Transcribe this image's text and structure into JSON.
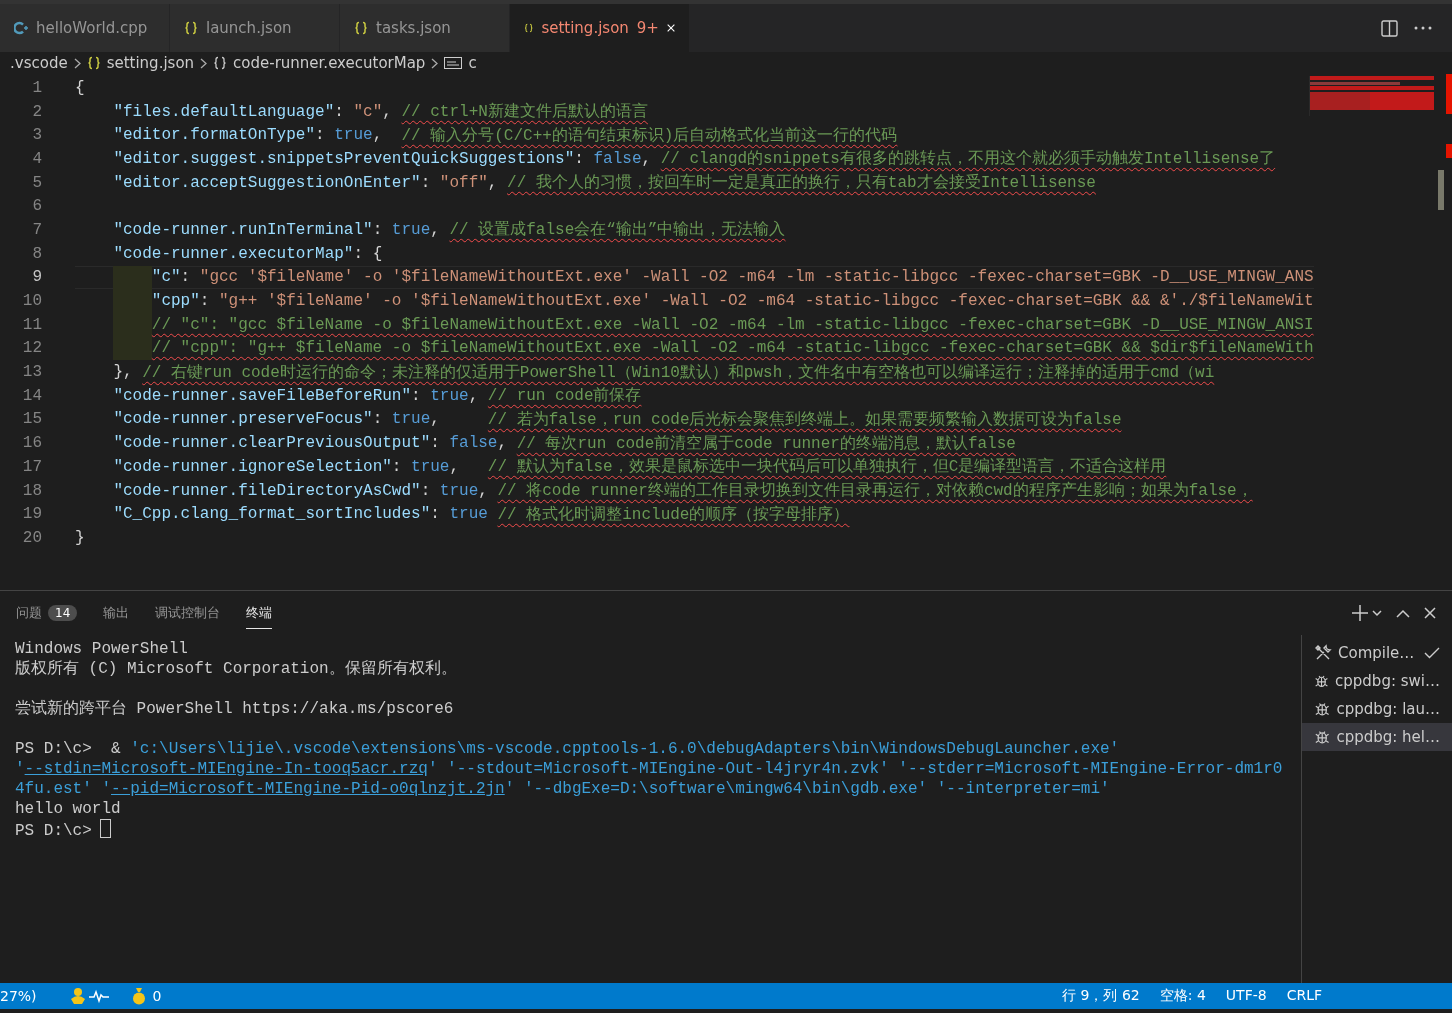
{
  "tabs": [
    {
      "label": "helloWorld.cpp",
      "kind": "cpp",
      "selected": false
    },
    {
      "label": "launch.json",
      "kind": "json",
      "selected": false
    },
    {
      "label": "tasks.json",
      "kind": "json",
      "selected": false
    },
    {
      "label": "setting.json",
      "kind": "json",
      "selected": true,
      "problems": "9+"
    }
  ],
  "breadcrumbs": [
    {
      "label": ".vscode",
      "kind": "folder"
    },
    {
      "label": "setting.json",
      "kind": "json"
    },
    {
      "label": "code-runner.executorMap",
      "kind": "object"
    },
    {
      "label": "c",
      "kind": "string"
    }
  ],
  "editor": {
    "lines": [
      {
        "number": "1",
        "current": false,
        "tokens": [
          {
            "kind": "punct",
            "text": "{"
          }
        ],
        "children": [
          {
            "number": "2",
            "current": false,
            "tokens": [
              {
                "kind": "key",
                "text": "\"files.defaultLanguage\""
              },
              {
                "kind": "punct",
                "text": ": "
              },
              {
                "kind": "string",
                "text": "\"c\""
              },
              {
                "kind": "punct",
                "text": ", "
              },
              {
                "kind": "comment",
                "text": "// ctrl+N新建文件后默认的语言"
              }
            ]
          },
          {
            "number": "3",
            "current": false,
            "tokens": [
              {
                "kind": "key",
                "text": "\"editor.formatOnType\""
              },
              {
                "kind": "punct",
                "text": ": "
              },
              {
                "kind": "bool",
                "text": "true"
              },
              {
                "kind": "punct",
                "text": ",  "
              },
              {
                "kind": "comment",
                "text": "// 输入分号(C/C++的语句结束标识)后自动格式化当前这一行的代码"
              }
            ]
          },
          {
            "number": "4",
            "current": false,
            "tokens": [
              {
                "kind": "key",
                "text": "\"editor.suggest.snippetsPreventQuickSuggestions\""
              },
              {
                "kind": "punct",
                "text": ": "
              },
              {
                "kind": "bool",
                "text": "false"
              },
              {
                "kind": "punct",
                "text": ", "
              },
              {
                "kind": "comment",
                "text": "// clangd的snippets有很多的跳转点，不用这个就必须手动触发Intellisense了"
              }
            ]
          },
          {
            "number": "5",
            "current": false,
            "tokens": [
              {
                "kind": "key",
                "text": "\"editor.acceptSuggestionOnEnter\""
              },
              {
                "kind": "punct",
                "text": ": "
              },
              {
                "kind": "string",
                "text": "\"off\""
              },
              {
                "kind": "punct",
                "text": ", "
              },
              {
                "kind": "comment",
                "text": "// 我个人的习惯，按回车时一定是真正的换行，只有tab才会接受Intellisense"
              }
            ]
          },
          {
            "number": "6",
            "current": false
          },
          {
            "number": "7",
            "current": false,
            "tokens": [
              {
                "kind": "key",
                "text": "\"code-runner.runInTerminal\""
              },
              {
                "kind": "punct",
                "text": ": "
              },
              {
                "kind": "bool",
                "text": "true"
              },
              {
                "kind": "punct",
                "text": ", "
              },
              {
                "kind": "comment",
                "text": "// 设置成false会在“输出”中输出，无法输入"
              }
            ]
          },
          {
            "number": "8",
            "current": false,
            "tokens": [
              {
                "kind": "key",
                "text": "\"code-runner.executorMap\""
              },
              {
                "kind": "punct",
                "text": ": {"
              }
            ],
            "children": [
              {
                "number": "9",
                "current": true,
                "tokens": [
                  {
                    "kind": "key",
                    "text": "\"c\""
                  },
                  {
                    "kind": "punct",
                    "text": ": "
                  },
                  {
                    "kind": "string",
                    "text": "\"gcc '$fileName' -o '$fileNameWithoutExt.exe' -Wall -O2 -m64 -lm -static-libgcc -fexec-charset=GBK -D__USE_MINGW_ANS"
                  }
                ]
              },
              {
                "number": "10",
                "current": false,
                "tokens": [
                  {
                    "kind": "key",
                    "text": "\"cpp\""
                  },
                  {
                    "kind": "punct",
                    "text": ": "
                  },
                  {
                    "kind": "string",
                    "text": "\"g++ '$fileName' -o '$fileNameWithoutExt.exe' -Wall -O2 -m64 -static-libgcc -fexec-charset=GBK && &'./$fileNameWit"
                  }
                ]
              },
              {
                "number": "11",
                "current": false,
                "tokens": [
                  {
                    "kind": "comment",
                    "text": "// \"c\": \"gcc $fileName -o $fileNameWithoutExt.exe -Wall -O2 -m64 -lm -static-libgcc -fexec-charset=GBK -D__USE_MINGW_ANSI"
                  }
                ]
              },
              {
                "number": "12",
                "current": false,
                "tokens": [
                  {
                    "kind": "comment",
                    "text": "// \"cpp\": \"g++ $fileName -o $fileNameWithoutExt.exe -Wall -O2 -m64 -static-libgcc -fexec-charset=GBK && $dir$fileNameWith"
                  }
                ]
              }
            ]
          },
          {
            "number": "13",
            "current": false,
            "tokens": [
              {
                "kind": "punct",
                "text": "}, "
              },
              {
                "kind": "comment",
                "text": "// 右键run code时运行的命令；未注释的仅适用于PowerShell（Win10默认）和pwsh，文件名中有空格也可以编译运行；注释掉的适用于cmd（wi"
              }
            ]
          },
          {
            "number": "14",
            "current": false,
            "tokens": [
              {
                "kind": "key",
                "text": "\"code-runner.saveFileBeforeRun\""
              },
              {
                "kind": "punct",
                "text": ": "
              },
              {
                "kind": "bool",
                "text": "true"
              },
              {
                "kind": "punct",
                "text": ", "
              },
              {
                "kind": "comment",
                "text": "// run code前保存"
              }
            ]
          },
          {
            "number": "15",
            "current": false,
            "tokens": [
              {
                "kind": "key",
                "text": "\"code-runner.preserveFocus\""
              },
              {
                "kind": "punct",
                "text": ": "
              },
              {
                "kind": "bool",
                "text": "true"
              },
              {
                "kind": "punct",
                "text": ",     "
              },
              {
                "kind": "comment",
                "text": "// 若为false，run code后光标会聚焦到终端上。如果需要频繁输入数据可设为false"
              }
            ]
          },
          {
            "number": "16",
            "current": false,
            "tokens": [
              {
                "kind": "key",
                "text": "\"code-runner.clearPreviousOutput\""
              },
              {
                "kind": "punct",
                "text": ": "
              },
              {
                "kind": "bool",
                "text": "false"
              },
              {
                "kind": "punct",
                "text": ", "
              },
              {
                "kind": "comment",
                "text": "// 每次run code前清空属于code runner的终端消息，默认false"
              }
            ]
          },
          {
            "number": "17",
            "current": false,
            "tokens": [
              {
                "kind": "key",
                "text": "\"code-runner.ignoreSelection\""
              },
              {
                "kind": "punct",
                "text": ": "
              },
              {
                "kind": "bool",
                "text": "true"
              },
              {
                "kind": "punct",
                "text": ",   "
              },
              {
                "kind": "comment",
                "text": "// 默认为false，效果是鼠标选中一块代码后可以单独执行，但C是编译型语言，不适合这样用"
              }
            ]
          },
          {
            "number": "18",
            "current": false,
            "tokens": [
              {
                "kind": "key",
                "text": "\"code-runner.fileDirectoryAsCwd\""
              },
              {
                "kind": "punct",
                "text": ": "
              },
              {
                "kind": "bool",
                "text": "true"
              },
              {
                "kind": "punct",
                "text": ", "
              },
              {
                "kind": "comment",
                "text": "// 将code runner终端的工作目录切换到文件目录再运行，对依赖cwd的程序产生影响；如果为false，"
              }
            ]
          },
          {
            "number": "19",
            "current": false,
            "tokens": [
              {
                "kind": "key",
                "text": "\"C_Cpp.clang_format_sortIncludes\""
              },
              {
                "kind": "punct",
                "text": ": "
              },
              {
                "kind": "bool",
                "text": "true"
              },
              {
                "kind": "comment",
                "text": "// 格式化时调整include的顺序（按字母排序）"
              }
            ]
          }
        ]
      },
      {
        "number": "20",
        "current": false,
        "tokens": [
          {
            "kind": "punct",
            "text": "}"
          }
        ]
      }
    ]
  },
  "panel": {
    "tabs": [
      {
        "label": "问题",
        "badge": "14",
        "selected": false
      },
      {
        "label": "输出",
        "selected": false
      },
      {
        "label": "调试控制台",
        "selected": false
      },
      {
        "label": "终端",
        "selected": true
      }
    ],
    "terminal": {
      "blocks": [
        [
          {
            "kind": "plain",
            "text": "Windows PowerShell"
          },
          {
            "kind": "plain",
            "text": "版权所有 (C) Microsoft Corporation。保留所有权利。"
          }
        ],
        [
          {
            "kind": "plain",
            "text": "尝试新的跨平台 PowerShell https://aka.ms/pscore6"
          }
        ],
        [
          {
            "kind": "command",
            "segments": [
              {
                "kind": "plain",
                "text": "PS D:\\c>  & "
              },
              {
                "kind": "string",
                "text": "'c:\\Users\\lijie\\.vscode\\extensions\\ms-vscode.cpptools-1.6.0\\debugAdapters\\bin\\WindowsDebugLauncher.exe' '"
              },
              {
                "kind": "link",
                "text": "--stdin=Microsoft-MIEngine-In-tooq5acr.rzq"
              },
              {
                "kind": "string",
                "text": "' '--stdout=Microsoft-MIEngine-Out-l4jryr4n.zvk' '--stderr=Microsoft-MIEngine-Error-dm1r04fu.est' '"
              },
              {
                "kind": "link",
                "text": "--pid=Microsoft-MIEngine-Pid-o0qlnzjt.2jn"
              },
              {
                "kind": "string",
                "text": "' '--dbgExe=D:\\software\\mingw64\\bin\\gdb.exe' '--interpreter=mi'"
              }
            ]
          },
          {
            "kind": "plain",
            "text": "hello world"
          },
          {
            "kind": "prompt",
            "text": "PS D:\\c>"
          }
        ]
      ]
    },
    "sessions": [
      {
        "label": "Compile…",
        "kind": "tools",
        "done": true,
        "selected": false
      },
      {
        "label": "cppdbg: swi…",
        "kind": "debug",
        "done": false,
        "selected": false
      },
      {
        "label": "cppdbg: lau…",
        "kind": "debug",
        "done": false,
        "selected": false
      },
      {
        "label": "cppdbg: hel…",
        "kind": "debug",
        "done": false,
        "selected": true
      }
    ]
  },
  "status_bar": {
    "left": [
      {
        "kind": "text",
        "text": "27%)"
      },
      {
        "kind": "activity"
      },
      {
        "kind": "coins",
        "text": "0"
      }
    ],
    "right": [
      "行 9，列 62",
      "空格: 4",
      "UTF-8",
      "CRLF"
    ]
  }
}
